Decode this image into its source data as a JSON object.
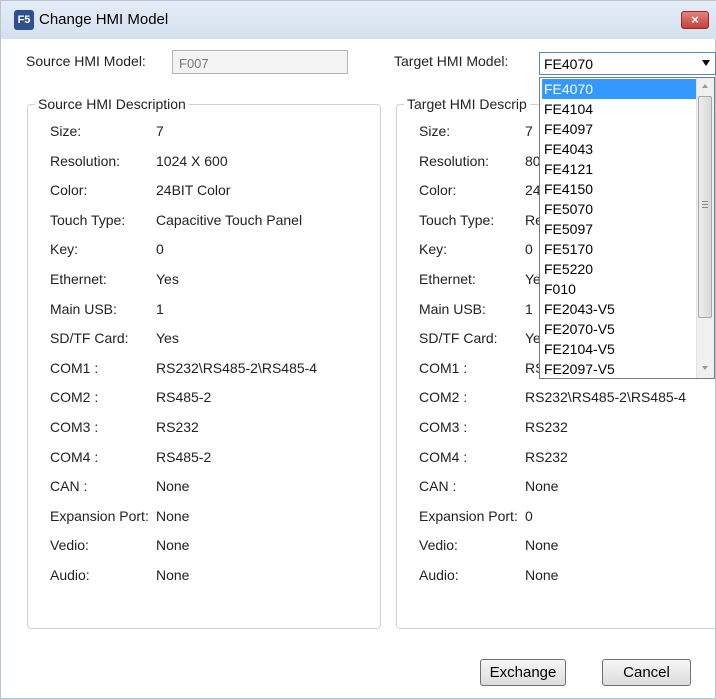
{
  "window": {
    "icon_text": "F5",
    "title": "Change HMI Model",
    "close_symbol": "×"
  },
  "source": {
    "label": "Source HMI Model:",
    "value": "F007",
    "desc_title": "Source HMI Description",
    "rows": [
      {
        "label": "Size:",
        "value": "7"
      },
      {
        "label": "Resolution:",
        "value": "1024 X 600"
      },
      {
        "label": "Color:",
        "value": "24BIT Color"
      },
      {
        "label": "Touch Type:",
        "value": "Capacitive Touch Panel"
      },
      {
        "label": "Key:",
        "value": "0"
      },
      {
        "label": "Ethernet:",
        "value": "Yes"
      },
      {
        "label": "Main USB:",
        "value": "1"
      },
      {
        "label": "SD/TF Card:",
        "value": "Yes"
      },
      {
        "label": "COM1 :",
        "value": "RS232\\RS485-2\\RS485-4"
      },
      {
        "label": "COM2 :",
        "value": "RS485-2"
      },
      {
        "label": "COM3 :",
        "value": "RS232"
      },
      {
        "label": "COM4 :",
        "value": "RS485-2"
      },
      {
        "label": "CAN :",
        "value": "None"
      },
      {
        "label": "Expansion Port:",
        "value": "None"
      },
      {
        "label": "Vedio:",
        "value": "None"
      },
      {
        "label": "Audio:",
        "value": "None"
      }
    ]
  },
  "target": {
    "label": "Target HMI Model:",
    "selected": "FE4070",
    "desc_title": "Target HMI Descrip",
    "rows": [
      {
        "label": "Size:",
        "value": "7"
      },
      {
        "label": "Resolution:",
        "value": "80"
      },
      {
        "label": "Color:",
        "value": "24"
      },
      {
        "label": "Touch Type:",
        "value": "Re"
      },
      {
        "label": "Key:",
        "value": "0"
      },
      {
        "label": "Ethernet:",
        "value": "Ye"
      },
      {
        "label": "Main USB:",
        "value": "1"
      },
      {
        "label": "SD/TF Card:",
        "value": "Ye"
      },
      {
        "label": "COM1 :",
        "value": "RS"
      },
      {
        "label": "COM2 :",
        "value": "RS232\\RS485-2\\RS485-4"
      },
      {
        "label": "COM3 :",
        "value": "RS232"
      },
      {
        "label": "COM4 :",
        "value": "RS232"
      },
      {
        "label": "CAN :",
        "value": "None"
      },
      {
        "label": "Expansion Port:",
        "value": "0"
      },
      {
        "label": "Vedio:",
        "value": "None"
      },
      {
        "label": "Audio:",
        "value": "None"
      }
    ],
    "options": [
      "FE4070",
      "FE4104",
      "FE4097",
      "FE4043",
      "FE4121",
      "FE4150",
      "FE5070",
      "FE5097",
      "FE5170",
      "FE5220",
      "F010",
      "FE2043-V5",
      "FE2070-V5",
      "FE2104-V5",
      "FE2097-V5"
    ]
  },
  "buttons": {
    "exchange": "Exchange",
    "cancel": "Cancel"
  },
  "colors": {
    "selection": "#3399ff",
    "close_button": "#c2423a"
  }
}
